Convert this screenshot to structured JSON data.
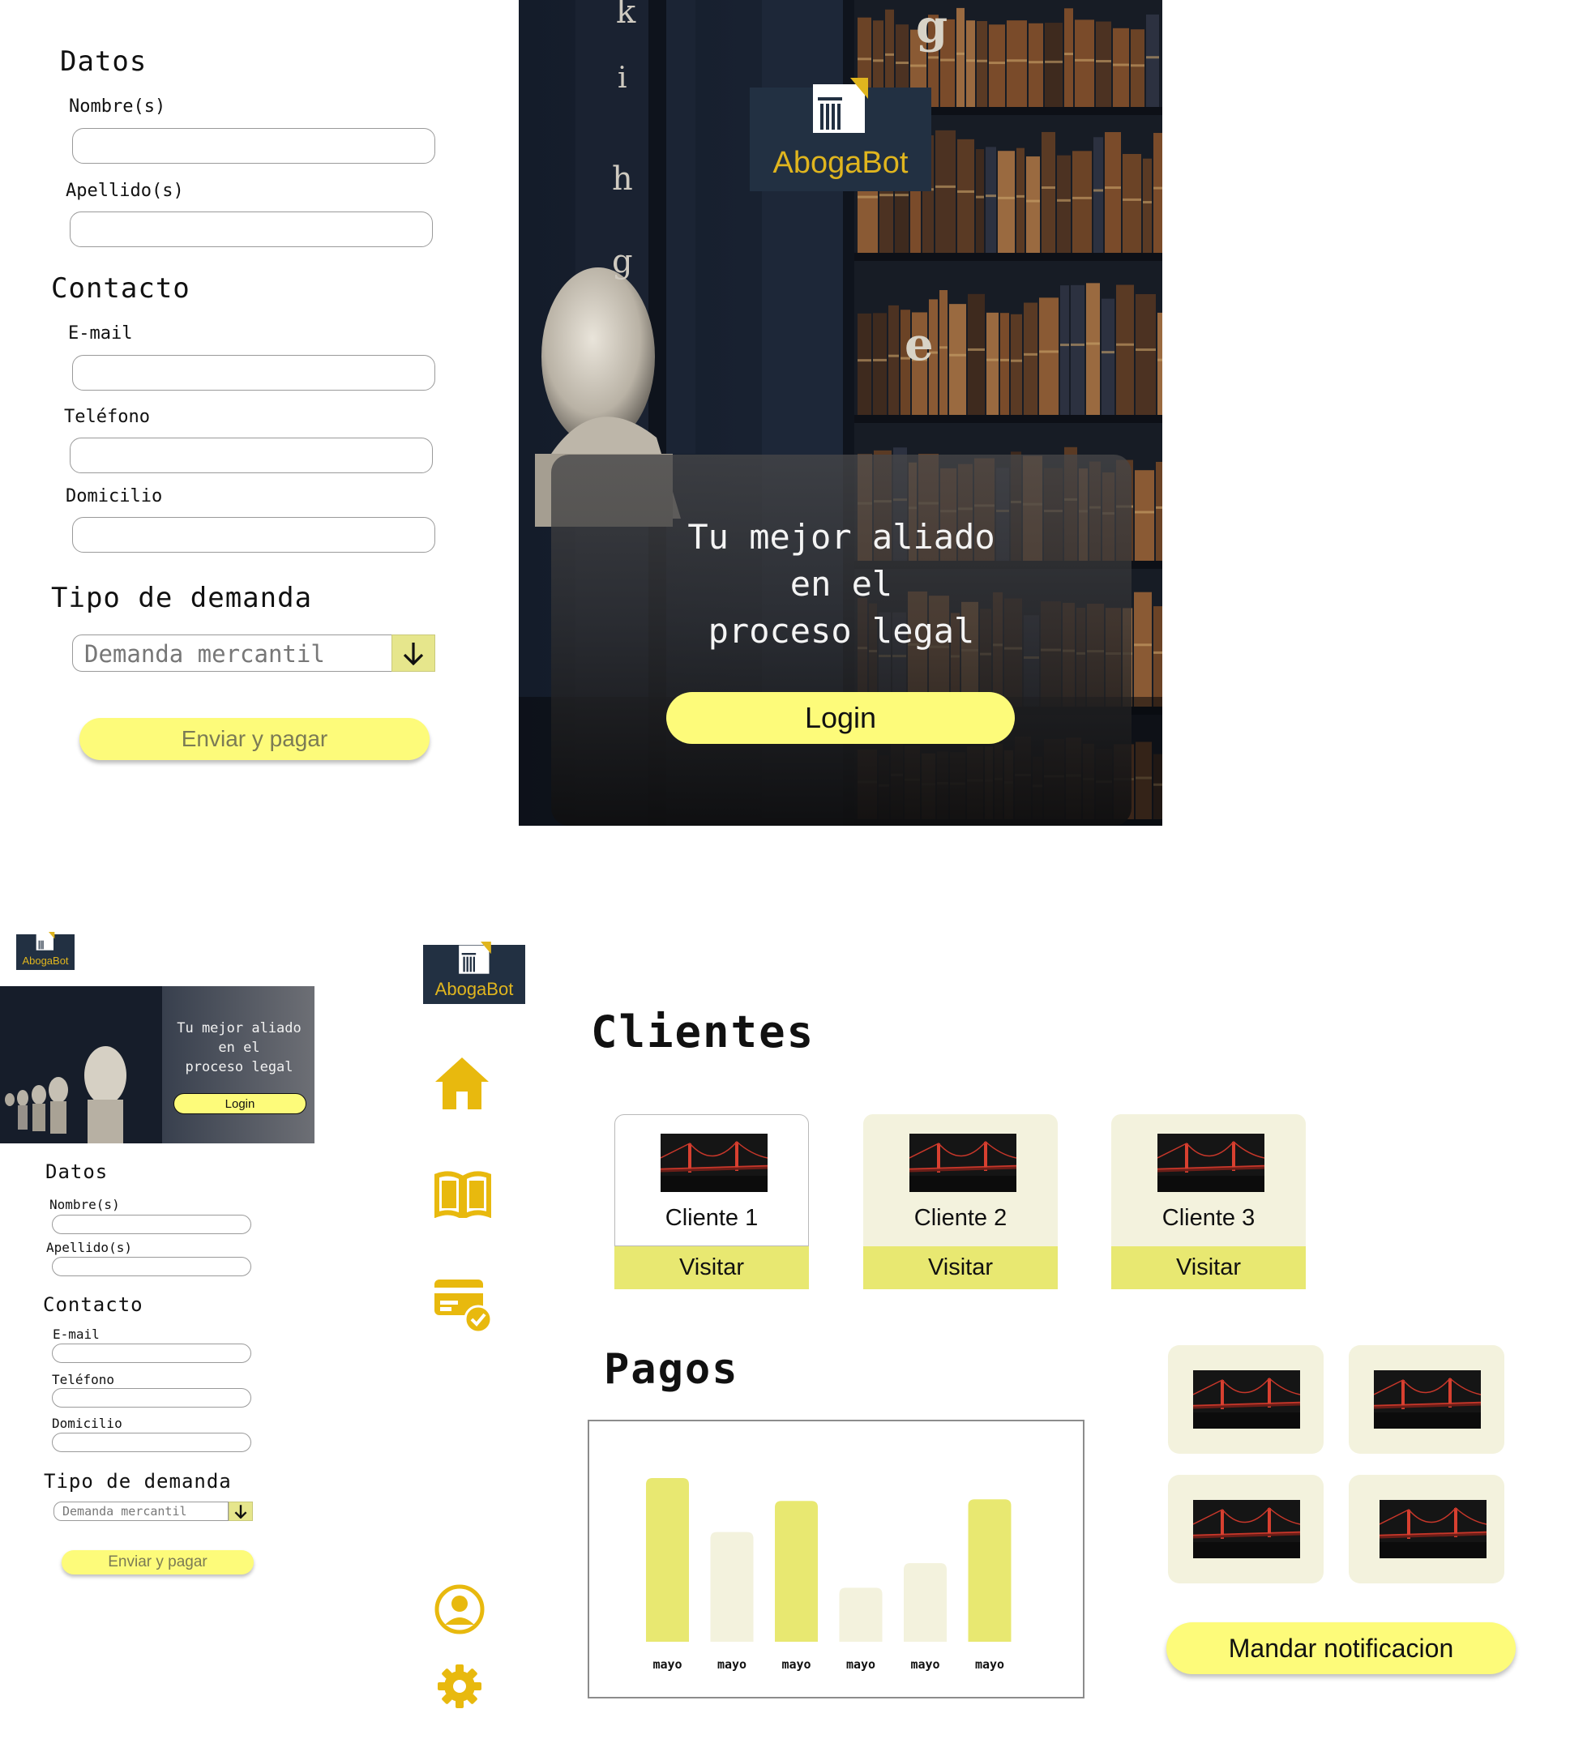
{
  "brand": {
    "name": "AbogaBot"
  },
  "form": {
    "section_datos": "Datos",
    "label_nombre": "Nombre(s)",
    "label_apellido": "Apellido(s)",
    "section_contacto": "Contacto",
    "label_email": "E-mail",
    "label_telefono": "Teléfono",
    "label_domicilio": "Domicilio",
    "section_tipo": "Tipo de demanda",
    "select_value": "Demanda mercantil",
    "submit_label": "Enviar y pagar"
  },
  "hero": {
    "tagline_line1": "Tu mejor aliado",
    "tagline_line2": "en el",
    "tagline_line3": "proceso legal",
    "login_label": "Login",
    "spine_letters": [
      "k",
      "i",
      "h",
      "g",
      "g",
      "e"
    ]
  },
  "dashboard": {
    "clients_title": "Clientes",
    "clients": [
      {
        "name": "Cliente 1",
        "action": "Visitar"
      },
      {
        "name": "Cliente 2",
        "action": "Visitar"
      },
      {
        "name": "Cliente 3",
        "action": "Visitar"
      }
    ],
    "payments_title": "Pagos",
    "notify_label": "Mandar notificacion",
    "nav": [
      "home-icon",
      "book-icon",
      "payment-card-icon",
      "user-icon",
      "gear-icon"
    ]
  },
  "colors": {
    "accent_yellow": "#fdfb7a",
    "bar_strong": "#e8e871",
    "bar_light": "#f3f2dd",
    "navy": "#223042",
    "gold": "#e0b51e"
  },
  "chart_data": {
    "type": "bar",
    "title": "Pagos",
    "categories": [
      "mayo",
      "mayo",
      "mayo",
      "mayo",
      "mayo",
      "mayo"
    ],
    "values": [
      100,
      67,
      86,
      33,
      48,
      87
    ],
    "ylim": [
      0,
      100
    ],
    "highlight": [
      true,
      false,
      true,
      false,
      false,
      true
    ],
    "grid": false
  }
}
